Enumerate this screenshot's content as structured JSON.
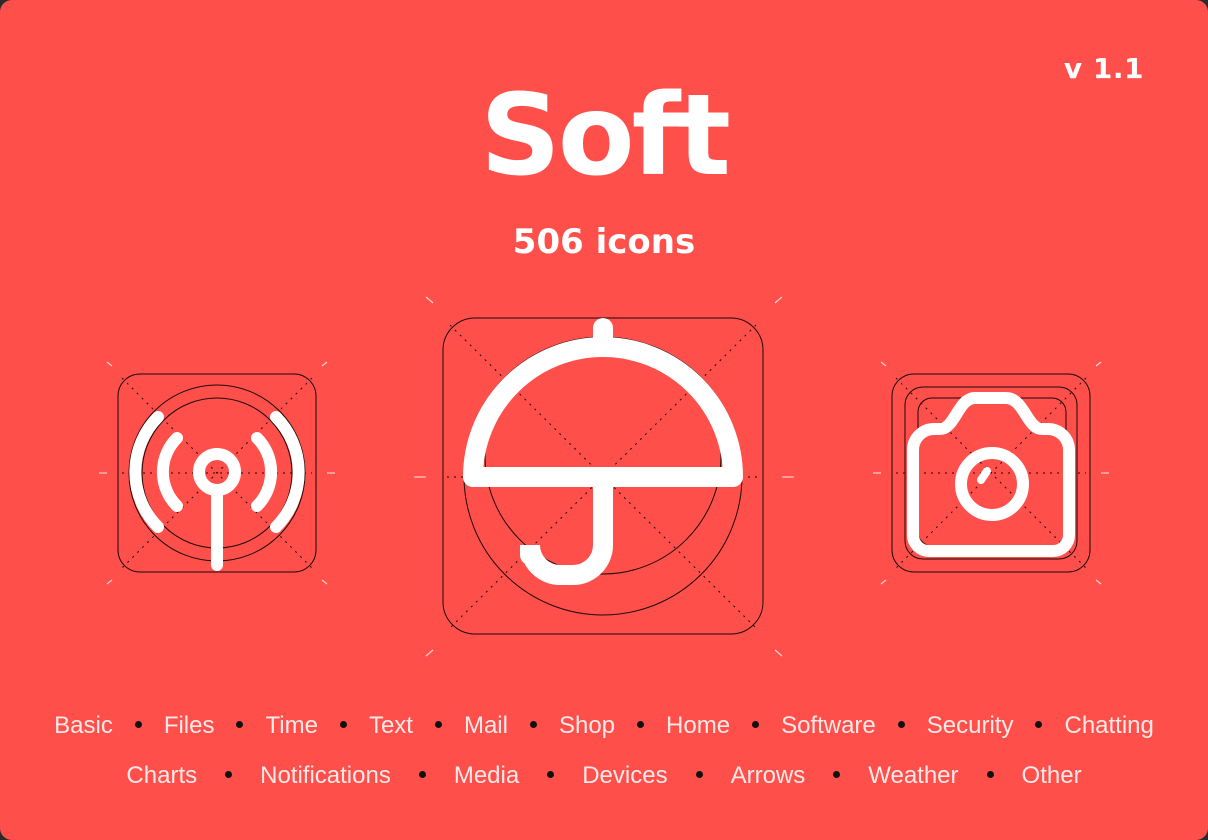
{
  "header": {
    "version": "v 1.1",
    "title": "Soft",
    "subtitle": "506 icons"
  },
  "colors": {
    "background": "#FF4F4B",
    "foreground": "#FFFFFF",
    "guide": "#1A0A0A"
  },
  "showcase": {
    "icons": [
      "broadcast-antenna-icon",
      "umbrella-icon",
      "camera-icon"
    ]
  },
  "categories": {
    "row1": [
      "Basic",
      "Files",
      "Time",
      "Text",
      "Mail",
      "Shop",
      "Home",
      "Software",
      "Security",
      "Chatting"
    ],
    "row2": [
      "Charts",
      "Notifications",
      "Media",
      "Devices",
      "Arrows",
      "Weather",
      "Other"
    ]
  }
}
